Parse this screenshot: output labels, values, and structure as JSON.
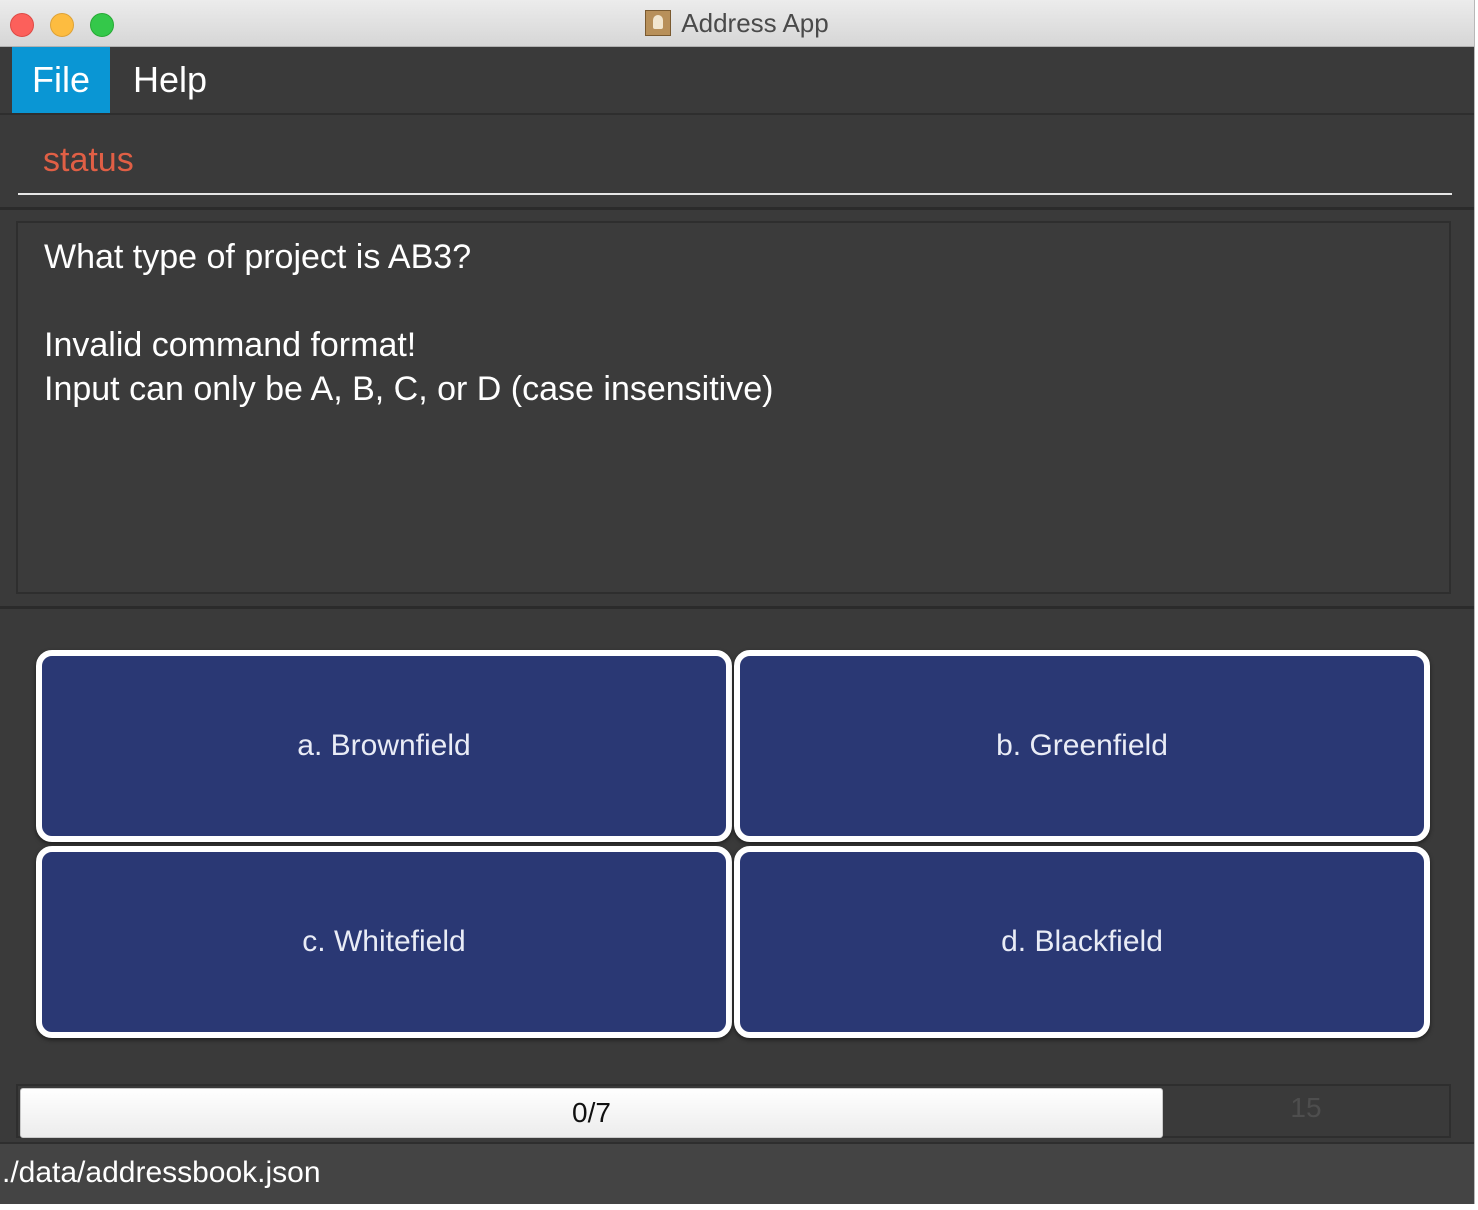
{
  "window": {
    "title": "Address App"
  },
  "menu": {
    "file": "File",
    "help": "Help"
  },
  "status": {
    "label": "status"
  },
  "result": {
    "lines": [
      "What type of project is AB3?",
      "",
      "Invalid command format!",
      "Input can only be A, B, C, or D (case insensitive)"
    ]
  },
  "answers": [
    {
      "label": "a. Brownfield"
    },
    {
      "label": "b. Greenfield"
    },
    {
      "label": "c. Whitefield"
    },
    {
      "label": "d. Blackfield"
    }
  ],
  "progress": {
    "text": "0/7",
    "timer": "15"
  },
  "footer": {
    "path": "./data/addressbook.json"
  },
  "colors": {
    "menu_active": "#0a96d4",
    "status_text": "#e05f45",
    "answer_bg": "#2a3874",
    "background": "#3a3a3a"
  }
}
